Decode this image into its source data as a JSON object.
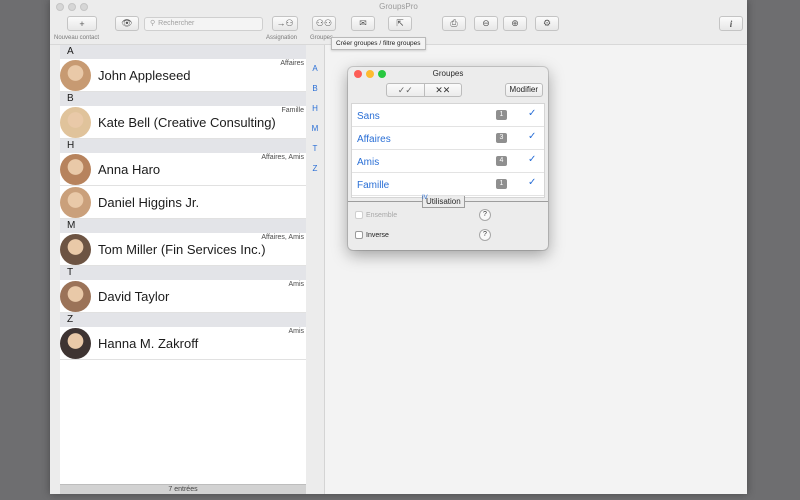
{
  "window": {
    "title": "GroupsPro"
  },
  "toolbar": {
    "add_label": "+",
    "new_contact_label": "Nouveau contact",
    "search_placeholder": "Rechercher",
    "assignation_label": "Assignation",
    "groups_label": "Groupes",
    "info_label": "i",
    "tooltip": "Créer groupes / filtre groupes"
  },
  "contacts": {
    "sections": [
      {
        "letter": "A",
        "items": [
          {
            "name": "John Appleseed",
            "groups": "Affaires"
          }
        ]
      },
      {
        "letter": "B",
        "items": [
          {
            "name": "Kate Bell (Creative Consulting)",
            "groups": "Famille"
          }
        ]
      },
      {
        "letter": "H",
        "items": [
          {
            "name": "Anna Haro",
            "groups": "Affaires, Amis"
          },
          {
            "name": "Daniel Higgins Jr.",
            "groups": ""
          }
        ]
      },
      {
        "letter": "M",
        "items": [
          {
            "name": "Tom Miller (Fin Services Inc.)",
            "groups": "Affaires, Amis"
          }
        ]
      },
      {
        "letter": "T",
        "items": [
          {
            "name": "David Taylor",
            "groups": "Amis"
          }
        ]
      },
      {
        "letter": "Z",
        "items": [
          {
            "name": "Hanna M. Zakroff",
            "groups": "Amis"
          }
        ]
      }
    ],
    "footer": "7 entrées"
  },
  "index_letters": [
    "A",
    "B",
    "H",
    "M",
    "T",
    "Z"
  ],
  "palette": {
    "title": "Groupes",
    "select_all": "✓✓",
    "deselect_all": "✕✕",
    "modify_label": "Modifier",
    "groups": [
      {
        "name": "Sans",
        "count": "1",
        "checked": true
      },
      {
        "name": "Affaires",
        "count": "3",
        "checked": true
      },
      {
        "name": "Amis",
        "count": "4",
        "checked": true
      },
      {
        "name": "Famille",
        "count": "1",
        "checked": true
      }
    ],
    "usage_label": "Utilisation",
    "usage_mark": "IV",
    "options": [
      {
        "label": "Ensemble",
        "enabled": false,
        "checked": false
      },
      {
        "label": "Inverse",
        "enabled": true,
        "checked": false
      }
    ]
  },
  "colors": {
    "accent": "#2a6fd6",
    "section_header": "#e3e4e8",
    "count_badge": "#8f8f8f"
  }
}
